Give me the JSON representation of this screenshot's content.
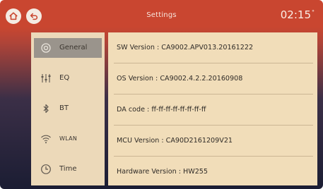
{
  "header": {
    "title": "Settings",
    "time": "02:15",
    "time_sup": "°"
  },
  "sidebar": {
    "items": [
      {
        "label": "General",
        "icon": "gear-icon",
        "active": true
      },
      {
        "label": "EQ",
        "icon": "equalizer-icon",
        "active": false
      },
      {
        "label": "BT",
        "icon": "bluetooth-icon",
        "active": false
      },
      {
        "label": "WLAN",
        "icon": "wifi-icon",
        "active": false
      },
      {
        "label": "Time",
        "icon": "clock-icon",
        "active": false
      }
    ]
  },
  "info": {
    "rows": [
      {
        "label": "SW Version :",
        "value": "CA9002.APV013.20161222"
      },
      {
        "label": "OS Version :",
        "value": "CA9002.4.2.2.20160908"
      },
      {
        "label": "DA code :",
        "value": "ff-ff-ff-ff-ff-ff-ff-ff"
      },
      {
        "label": "MCU Version :",
        "value": "CA90D2161209V21"
      },
      {
        "label": "Hardware Version :",
        "value": "HW255"
      }
    ]
  },
  "colors": {
    "header_red": "#c94630",
    "panel_beige": "#f1ddb9",
    "sidebar_beige": "#ecd9b9",
    "active_gray": "#9a948c"
  }
}
